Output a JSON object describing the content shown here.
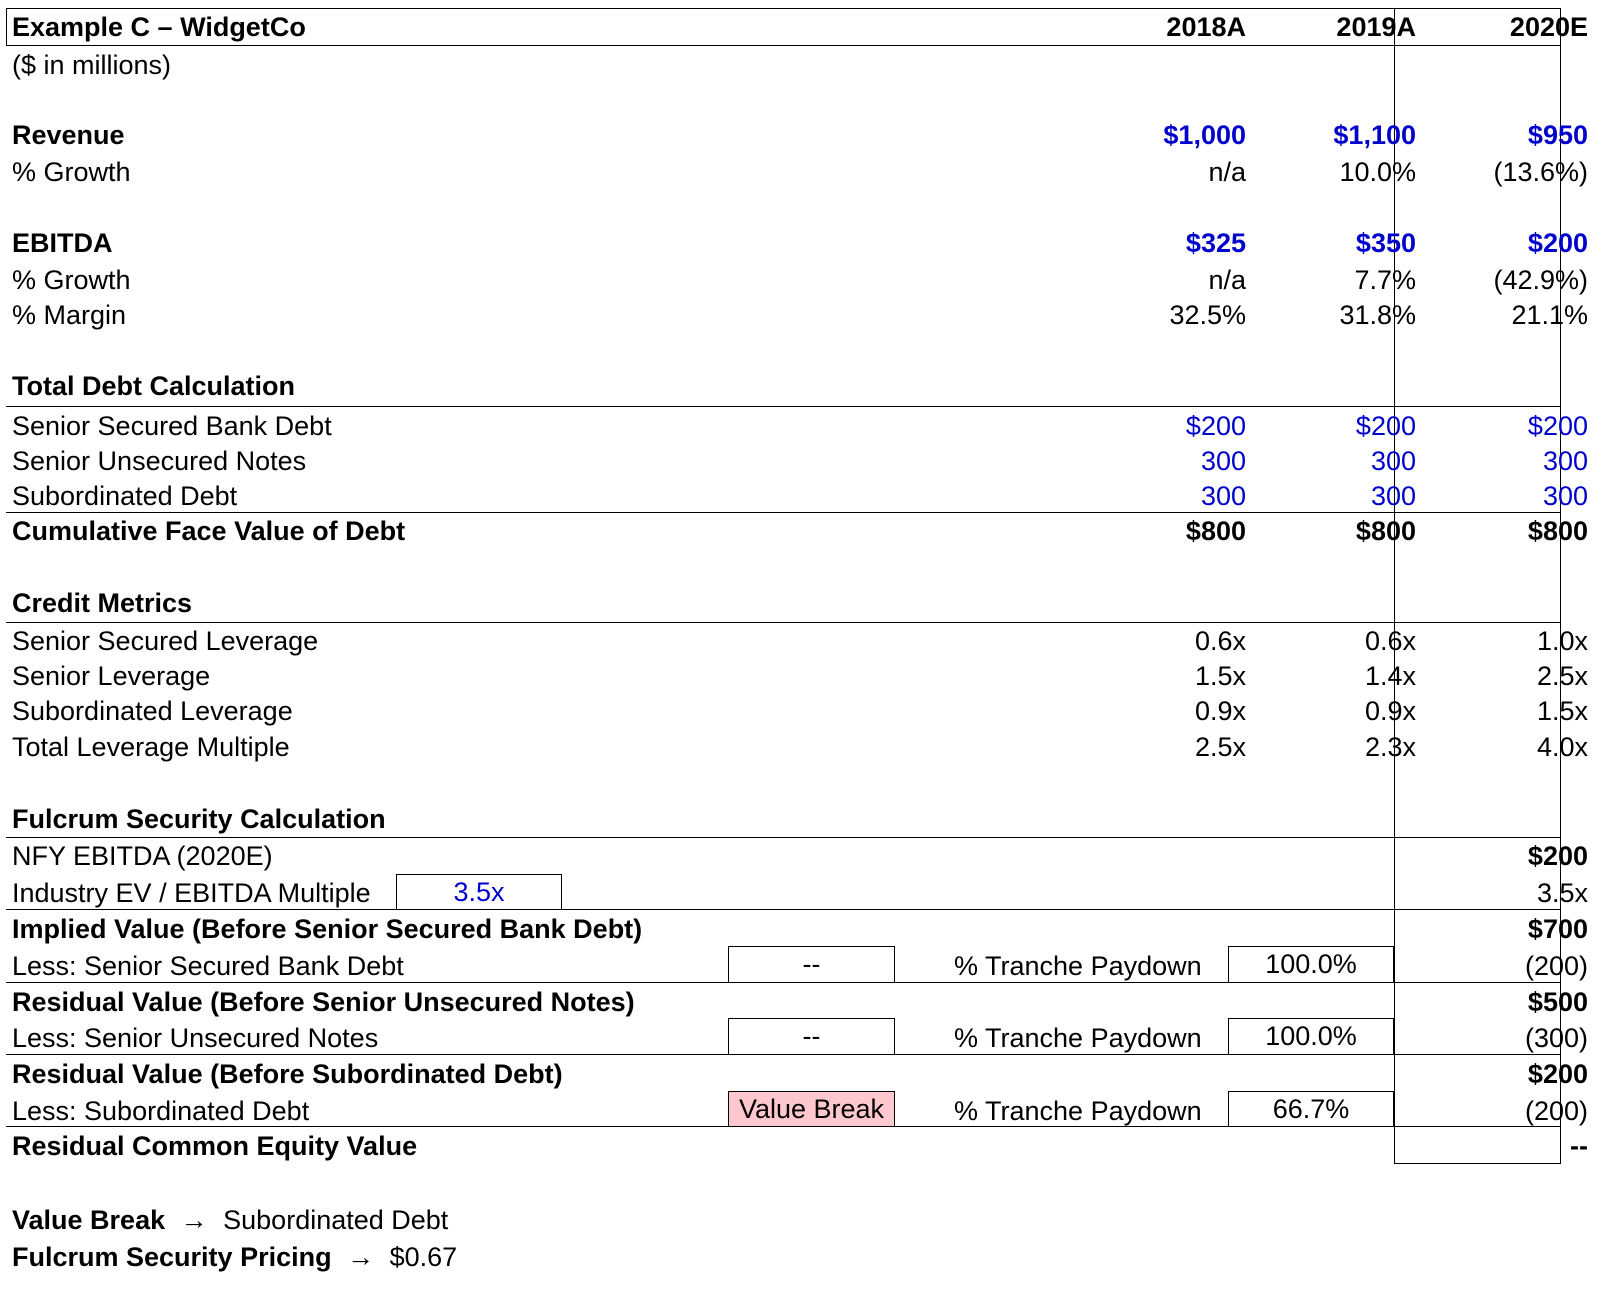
{
  "header": {
    "title": "Example C – WidgetCo",
    "subtitle": "($ in millions)",
    "years": [
      "2018A",
      "2019A",
      "2020E"
    ]
  },
  "revenue": {
    "label": "Revenue",
    "values": [
      "$1,000",
      "$1,100",
      "$950"
    ],
    "growth_label": "% Growth",
    "growth": [
      "n/a",
      "10.0%",
      "(13.6%)"
    ]
  },
  "ebitda": {
    "label": "EBITDA",
    "values": [
      "$325",
      "$350",
      "$200"
    ],
    "growth_label": "% Growth",
    "growth": [
      "n/a",
      "7.7%",
      "(42.9%)"
    ],
    "margin_label": "% Margin",
    "margin": [
      "32.5%",
      "31.8%",
      "21.1%"
    ]
  },
  "debt": {
    "title": "Total Debt Calculation",
    "rows": [
      {
        "label": "Senior Secured Bank Debt",
        "values": [
          "$200",
          "$200",
          "$200"
        ]
      },
      {
        "label": "Senior Unsecured Notes",
        "values": [
          "300",
          "300",
          "300"
        ]
      },
      {
        "label": "Subordinated Debt",
        "values": [
          "300",
          "300",
          "300"
        ]
      }
    ],
    "total_label": "Cumulative Face Value of Debt",
    "total": [
      "$800",
      "$800",
      "$800"
    ]
  },
  "credit": {
    "title": "Credit Metrics",
    "rows": [
      {
        "label": "Senior Secured Leverage",
        "values": [
          "0.6x",
          "0.6x",
          "1.0x"
        ]
      },
      {
        "label": "Senior Leverage",
        "values": [
          "1.5x",
          "1.4x",
          "2.5x"
        ]
      },
      {
        "label": "Subordinated Leverage",
        "values": [
          "0.9x",
          "0.9x",
          "1.5x"
        ]
      },
      {
        "label": "Total Leverage Multiple",
        "values": [
          "2.5x",
          "2.3x",
          "4.0x"
        ]
      }
    ]
  },
  "fulcrum": {
    "title": "Fulcrum Security Calculation",
    "nfy_label": "NFY EBITDA (2020E)",
    "nfy_value": "$200",
    "multiple_label": "Industry EV / EBITDA Multiple",
    "multiple_input": "3.5x",
    "multiple_value": "3.5x",
    "implied_label": "Implied Value (Before Senior Secured Bank Debt)",
    "implied_value": "$700",
    "less_ssbd_label": "Less: Senior Secured Bank Debt",
    "less_ssbd_flag": "--",
    "paydown_label": "% Tranche Paydown",
    "less_ssbd_paydown": "100.0%",
    "less_ssbd_value": "(200)",
    "resid1_label": "Residual Value (Before Senior Unsecured Notes)",
    "resid1_value": "$500",
    "less_sun_label": "Less: Senior Unsecured Notes",
    "less_sun_flag": "--",
    "less_sun_paydown": "100.0%",
    "less_sun_value": "(300)",
    "resid2_label": "Residual Value (Before Subordinated Debt)",
    "resid2_value": "$200",
    "less_sub_label": "Less: Subordinated Debt",
    "less_sub_flag": "Value Break",
    "less_sub_paydown": "66.7%",
    "less_sub_value": "(200)",
    "equity_label": "Residual Common Equity Value",
    "equity_value": "--"
  },
  "summary": {
    "value_break_label": "Value Break",
    "arrow": "→",
    "value_break_value": "Subordinated Debt",
    "pricing_label": "Fulcrum Security Pricing",
    "pricing_value": "$0.67"
  },
  "colors": {
    "input_blue": "#0000cc",
    "value_break_fill": "#ffc7ce"
  }
}
